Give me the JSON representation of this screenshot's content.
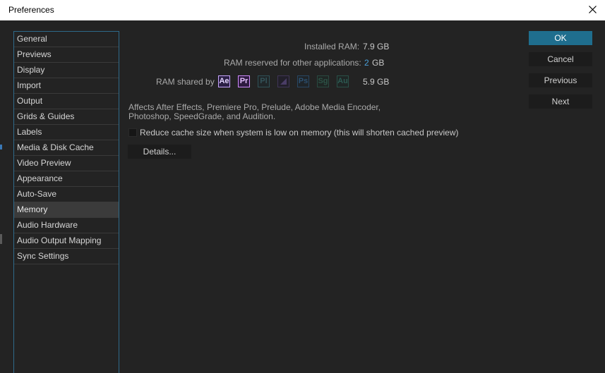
{
  "window": {
    "title": "Preferences",
    "close_icon": "close-icon"
  },
  "sidebar": {
    "items": [
      {
        "label": "General"
      },
      {
        "label": "Previews"
      },
      {
        "label": "Display"
      },
      {
        "label": "Import"
      },
      {
        "label": "Output"
      },
      {
        "label": "Grids & Guides"
      },
      {
        "label": "Labels"
      },
      {
        "label": "Media & Disk Cache"
      },
      {
        "label": "Video Preview"
      },
      {
        "label": "Appearance"
      },
      {
        "label": "Auto-Save"
      },
      {
        "label": "Memory"
      },
      {
        "label": "Audio Hardware"
      },
      {
        "label": "Audio Output Mapping"
      },
      {
        "label": "Sync Settings"
      }
    ],
    "selected": "Memory"
  },
  "memory": {
    "installed_ram_label": "Installed RAM:",
    "installed_ram_value": "7.9 GB",
    "reserved_label": "RAM reserved for other applications:",
    "reserved_value": "2",
    "reserved_unit": "GB",
    "shared_label": "RAM shared by",
    "apps": [
      "Ae",
      "Pr",
      "Pl",
      "Me",
      "Ps",
      "Sg",
      "Au"
    ],
    "shared_value": "5.9 GB",
    "description": "Affects After Effects, Premiere Pro, Prelude, Adobe Media Encoder, Photoshop, SpeedGrade, and Audition.",
    "reduce_cache_label": "Reduce cache size when system is low on memory (this will shorten cached preview)",
    "details_label": "Details..."
  },
  "buttons": {
    "ok": "OK",
    "cancel": "Cancel",
    "previous": "Previous",
    "next": "Next"
  },
  "colors": {
    "accent": "#1f6e8e",
    "panel": "#232323",
    "highlight": "#3b3b3b",
    "link_value": "#4a9fd8"
  }
}
